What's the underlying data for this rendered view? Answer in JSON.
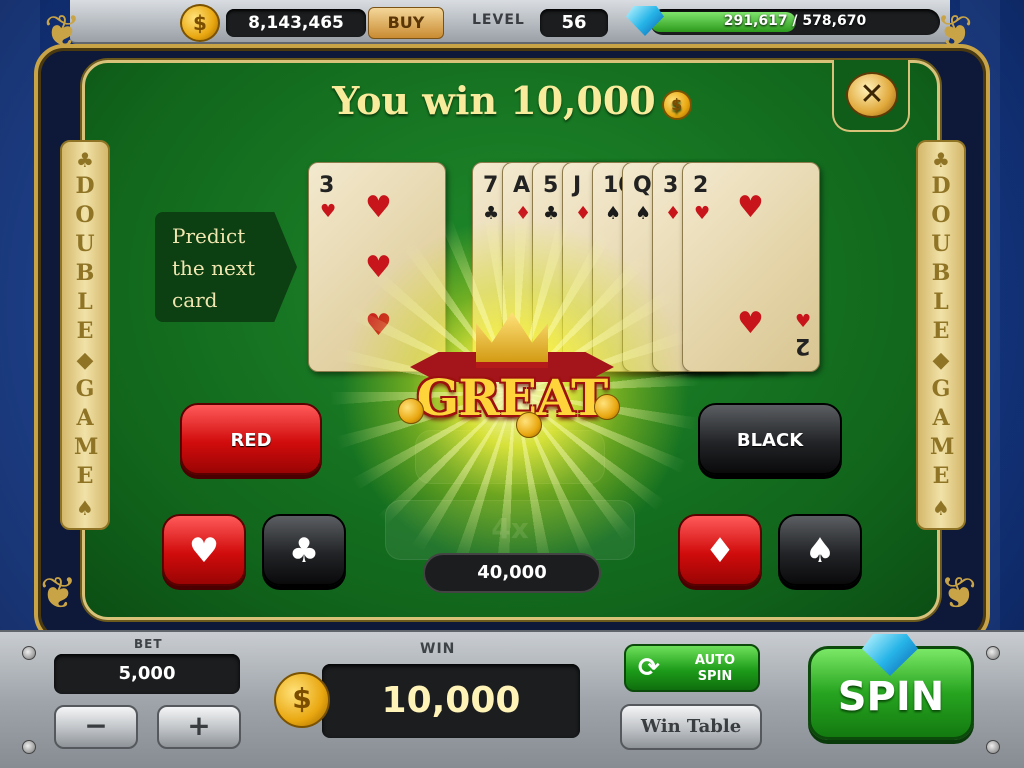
{
  "colors": {
    "table_green": "#11661c",
    "gold_text": "#f8ec9c",
    "red_button": "#d10c0c",
    "black_button": "#222427",
    "spin_green": "#27a420"
  },
  "top_bar": {
    "coins": "8,143,465",
    "buy_label": "BUY",
    "level_label": "LEVEL",
    "level_value": "56",
    "xp_text": "291,617 / 578,670",
    "xp_progress": 0.504,
    "coin_icon": "coin-stack-icon",
    "gem_icon": "diamond-icon"
  },
  "game": {
    "title": "You win 10,000",
    "side_banner_text": "DOUBLE◆GAME",
    "predict_text": "Predict the next card",
    "effect_text": "GREAT",
    "red_label": "RED",
    "black_label": "BLACK",
    "suits": {
      "heart": "♥",
      "club": "♣",
      "diamond": "♦",
      "spade": "♠"
    },
    "current_card": {
      "rank": "3",
      "suit": "♥"
    },
    "history_cards": [
      {
        "rank": "7",
        "suit": "♣"
      },
      {
        "rank": "A",
        "suit": "♦"
      },
      {
        "rank": "5",
        "suit": "♣"
      },
      {
        "rank": "J",
        "suit": "♦"
      },
      {
        "rank": "10",
        "suit": "♠"
      },
      {
        "rank": "Q",
        "suit": "♠"
      },
      {
        "rank": "3",
        "suit": "♦"
      },
      {
        "rank": "2",
        "suit": "♥"
      }
    ],
    "faint_multiplier": "4x",
    "payout_amount": "40,000",
    "close_symbol": "✕"
  },
  "bottom_bar": {
    "bet_label": "BET",
    "bet_value": "5,000",
    "minus_label": "−",
    "plus_label": "+",
    "win_label": "WIN",
    "win_value": "10,000",
    "auto_spin_label": "AUTO SPIN",
    "win_table_label": "Win Table",
    "spin_label": "SPIN"
  }
}
